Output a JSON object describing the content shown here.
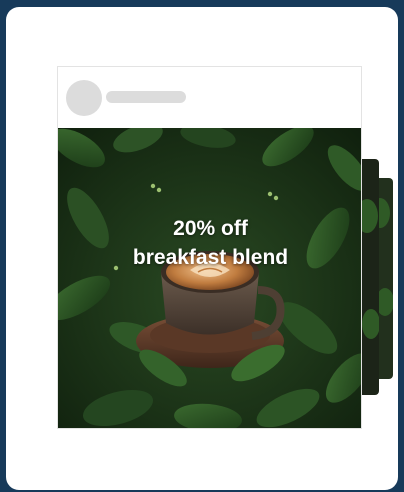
{
  "post": {
    "headline_line1": "20% off",
    "headline_line2": "breakfast blend",
    "badge_icon": "sparkle-icon"
  },
  "colors": {
    "background": "#173a5a",
    "card": "#ffffff",
    "placeholder": "#dcdcdc",
    "foliage": "#1f3d1b",
    "coffee": "#b8733a"
  }
}
